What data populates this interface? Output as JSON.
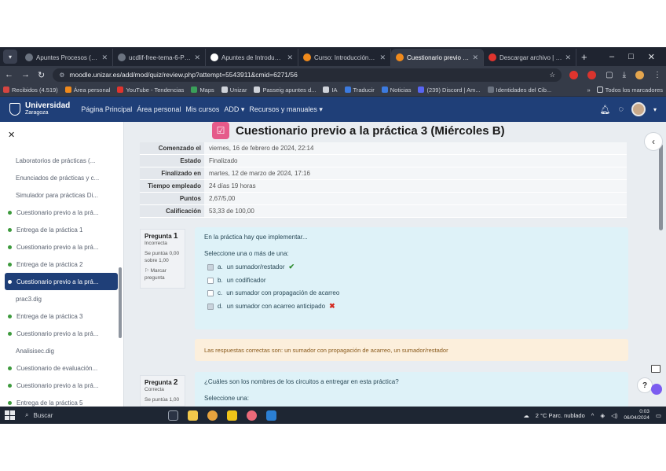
{
  "browser": {
    "tabs": [
      {
        "title": "Apuntes Procesos (estudio)",
        "color": "#6b7380"
      },
      {
        "title": "ucdlif-free-tema-6-Proces",
        "color": "#6b7380"
      },
      {
        "title": "Apuntes de Introducción a",
        "color": "#ffffff"
      },
      {
        "title": "Curso: Introducción a la c",
        "color": "#f08a1c"
      },
      {
        "title": "Cuestionario previo a la pr",
        "color": "#f08a1c"
      },
      {
        "title": "Descargar archivo | Uvest",
        "color": "#e0342e"
      }
    ],
    "active_tab_index": 4,
    "url": "moodle.unizar.es/add/mod/quiz/review.php?attempt=5543911&cmid=6271/56",
    "bookmarks": [
      "Recibidos (4.519)",
      "Área personal",
      "YouTube - Tendencias",
      "Maps",
      "Unizar",
      "Passeig apuntes d...",
      "IA",
      "Traducir",
      "Noticias",
      "(239) Discord | Am...",
      "Identidades del Cib..."
    ],
    "bookmarks_right": "Todos los marcadores"
  },
  "moodle": {
    "university": "Universidad",
    "city": "Zaragoza",
    "nav": [
      "Página Principal",
      "Área personal",
      "Mis cursos",
      "ADD ▾",
      "Recursos y manuales ▾"
    ]
  },
  "drawer": {
    "items": [
      {
        "label": "Laboratorios de prácticas (...",
        "bullet": false,
        "active": false
      },
      {
        "label": "Enunciados de prácticas y c...",
        "bullet": false,
        "active": false
      },
      {
        "label": "Simulador para prácticas Di...",
        "bullet": false,
        "active": false
      },
      {
        "label": "Cuestionario previo a la prá...",
        "bullet": true,
        "active": false
      },
      {
        "label": "Entrega de la práctica 1",
        "bullet": true,
        "active": false
      },
      {
        "label": "Cuestionario previo a la prá...",
        "bullet": true,
        "active": false
      },
      {
        "label": "Entrega de la práctica 2",
        "bullet": true,
        "active": false
      },
      {
        "label": "Cuestionario previo a la prá...",
        "bullet": true,
        "active": true
      },
      {
        "label": "prac3.dig",
        "bullet": false,
        "active": false
      },
      {
        "label": "Entrega de la práctica 3",
        "bullet": true,
        "active": false
      },
      {
        "label": "Cuestionario previo a la prá...",
        "bullet": true,
        "active": false
      },
      {
        "label": "Analisisec.dig",
        "bullet": false,
        "active": false
      },
      {
        "label": "Cuestionario de evaluación...",
        "bullet": true,
        "active": false
      },
      {
        "label": "Cuestionario previo a la prá...",
        "bullet": true,
        "active": false
      },
      {
        "label": "Entrega de la práctica 5",
        "bullet": true,
        "active": false
      }
    ]
  },
  "quiz": {
    "title": "Cuestionario previo a la práctica 3 (Miércoles B)",
    "summary": [
      {
        "k": "Comenzado el",
        "v": "viernes, 16 de febrero de 2024, 22:14"
      },
      {
        "k": "Estado",
        "v": "Finalizado"
      },
      {
        "k": "Finalizado en",
        "v": "martes, 12 de marzo de 2024, 17:16"
      },
      {
        "k": "Tiempo empleado",
        "v": "24 días 19 horas"
      },
      {
        "k": "Puntos",
        "v": "2,67/5,00"
      },
      {
        "k": "Calificación",
        "v": "53,33 de 100,00"
      }
    ],
    "q1": {
      "label": "Pregunta",
      "num": "1",
      "status": "Incorrecta",
      "score": "Se puntúa 0,00 sobre 1,00",
      "flag": "Marcar pregunta",
      "text": "En la práctica hay que implementar...",
      "prompt": "Seleccione una o más de una:",
      "options": [
        {
          "letter": "a.",
          "text": "un sumador/restador",
          "checked": true,
          "mark": "ok"
        },
        {
          "letter": "b.",
          "text": "un codificador",
          "checked": false,
          "mark": ""
        },
        {
          "letter": "c.",
          "text": "un sumador con propagación de acarreo",
          "checked": false,
          "mark": ""
        },
        {
          "letter": "d.",
          "text": "un sumador con acarreo anticipado",
          "checked": true,
          "mark": "bad"
        }
      ],
      "feedback": "Las respuestas correctas son: un sumador con propagación de acarreo, un sumador/restador"
    },
    "q2": {
      "label": "Pregunta",
      "num": "2",
      "status": "Correcta",
      "score": "Se puntúa 1,00",
      "text": "¿Cuáles son los nombres de los circuitos a entregar en esta práctica?",
      "prompt": "Seleccione una:"
    }
  },
  "taskbar": {
    "search": "Buscar",
    "weather": "2 °C Parc. nublado",
    "time": "0:03",
    "date": "06/04/2024"
  }
}
